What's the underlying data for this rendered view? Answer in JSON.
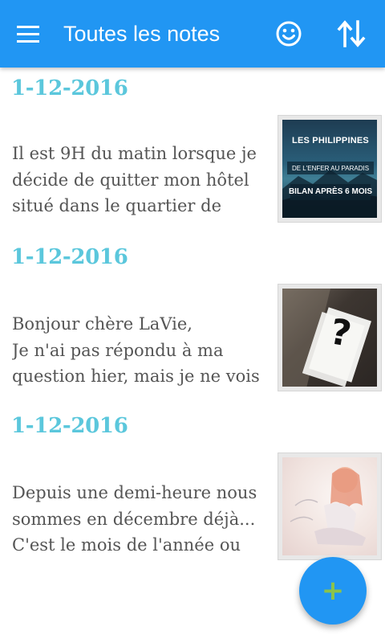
{
  "appbar": {
    "title": "Toutes les notes",
    "menu_icon": "menu-icon",
    "smiley_icon": "smiley-icon",
    "sort_icon": "sort-icon",
    "color": "#2196f3"
  },
  "notes": [
    {
      "date": "1-12-2016",
      "lines": [
        "Il est 9H du matin lorsque je",
        "décide de quitter mon hôtel",
        "situé dans le quartier de"
      ],
      "thumbnail": {
        "lines": [
          "LES PHILIPPINES",
          "DE L'ENFER AU PARADIS",
          "BILAN APRÈS 6 MOIS"
        ]
      }
    },
    {
      "date": "1-12-2016",
      "lines": [
        "Bonjour chère LaVie,",
        "Je n'ai pas répondu à ma",
        "question hier, mais je ne vois"
      ],
      "thumbnail": {
        "symbol": "?"
      }
    },
    {
      "date": "1-12-2016",
      "lines": [
        "Depuis une demi-heure nous",
        "sommes en décembre déjà...",
        "C'est le mois de l'année ou"
      ],
      "thumbnail": {}
    }
  ],
  "fab": {
    "label": "+",
    "icon": "plus-icon"
  },
  "colors": {
    "date": "#5bc7dc",
    "text": "#555555",
    "fab_plus": "#8bc34a"
  }
}
